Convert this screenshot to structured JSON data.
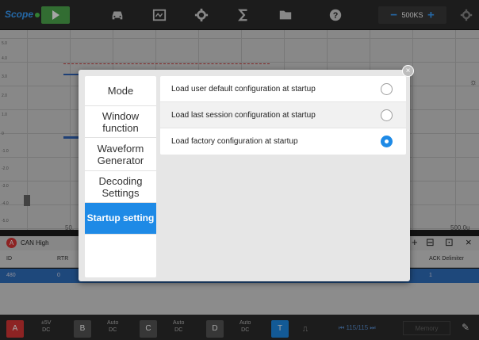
{
  "app": {
    "brand": "Scope"
  },
  "toolbar": {
    "timebase_value": "500KS",
    "timebase_minus": "−",
    "timebase_plus": "+"
  },
  "axis": {
    "y_ticks": [
      "5.0",
      "4.0",
      "3.0",
      "2.0",
      "1.0",
      "0",
      "-1.0",
      "-2.0",
      "-3.0",
      "-4.0",
      "-5.0"
    ],
    "time_left": "50.",
    "time_right": "500.0u"
  },
  "decode": {
    "channel_badge": "A",
    "channel_name": "CAN High",
    "columns": [
      "ID",
      "RTR",
      "ACK Delimiter"
    ],
    "row": {
      "id": "480",
      "rtr": "0",
      "ack": "1"
    }
  },
  "bottombar": {
    "channels": [
      {
        "letter": "A",
        "color": "#d93636",
        "setting": "±5V",
        "coupling": "DC"
      },
      {
        "letter": "B",
        "color": "#555555",
        "setting": "Auto",
        "coupling": "DC"
      },
      {
        "letter": "C",
        "color": "#555555",
        "setting": "Auto",
        "coupling": "DC"
      },
      {
        "letter": "D",
        "color": "#555555",
        "setting": "Auto",
        "coupling": "DC"
      }
    ],
    "trigger": "T",
    "pager": "115/115",
    "memory_label": "Memory"
  },
  "dialog": {
    "menu": [
      {
        "label": "Mode",
        "active": false
      },
      {
        "label": "Window function",
        "active": false
      },
      {
        "label": "Waveform Generator",
        "active": false
      },
      {
        "label": "Decoding Settings",
        "active": false
      },
      {
        "label": "Startup setting",
        "active": true
      }
    ],
    "options": [
      {
        "label": "Load user default configuration at startup",
        "selected": false
      },
      {
        "label": "Load last session configuration at startup",
        "selected": false
      },
      {
        "label": "Load factory configuration at startup",
        "selected": true
      }
    ],
    "close_symbol": "×"
  }
}
